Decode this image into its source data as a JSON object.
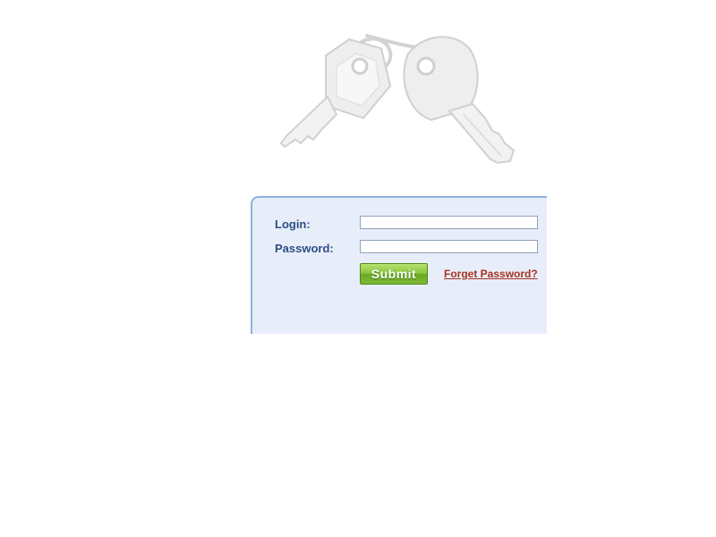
{
  "login_form": {
    "login_label": "Login:",
    "login_value": "",
    "password_label": "Password:",
    "password_value": "",
    "submit_label": "Submit",
    "forget_password_label": "Forget Password?"
  },
  "icons": {
    "header_image": "keys-icon"
  },
  "colors": {
    "panel_background": "#e8eef9",
    "panel_border": "#8fb0de",
    "label_text": "#2c4f86",
    "submit_green": "#86c33a",
    "link_red": "#a83221"
  }
}
